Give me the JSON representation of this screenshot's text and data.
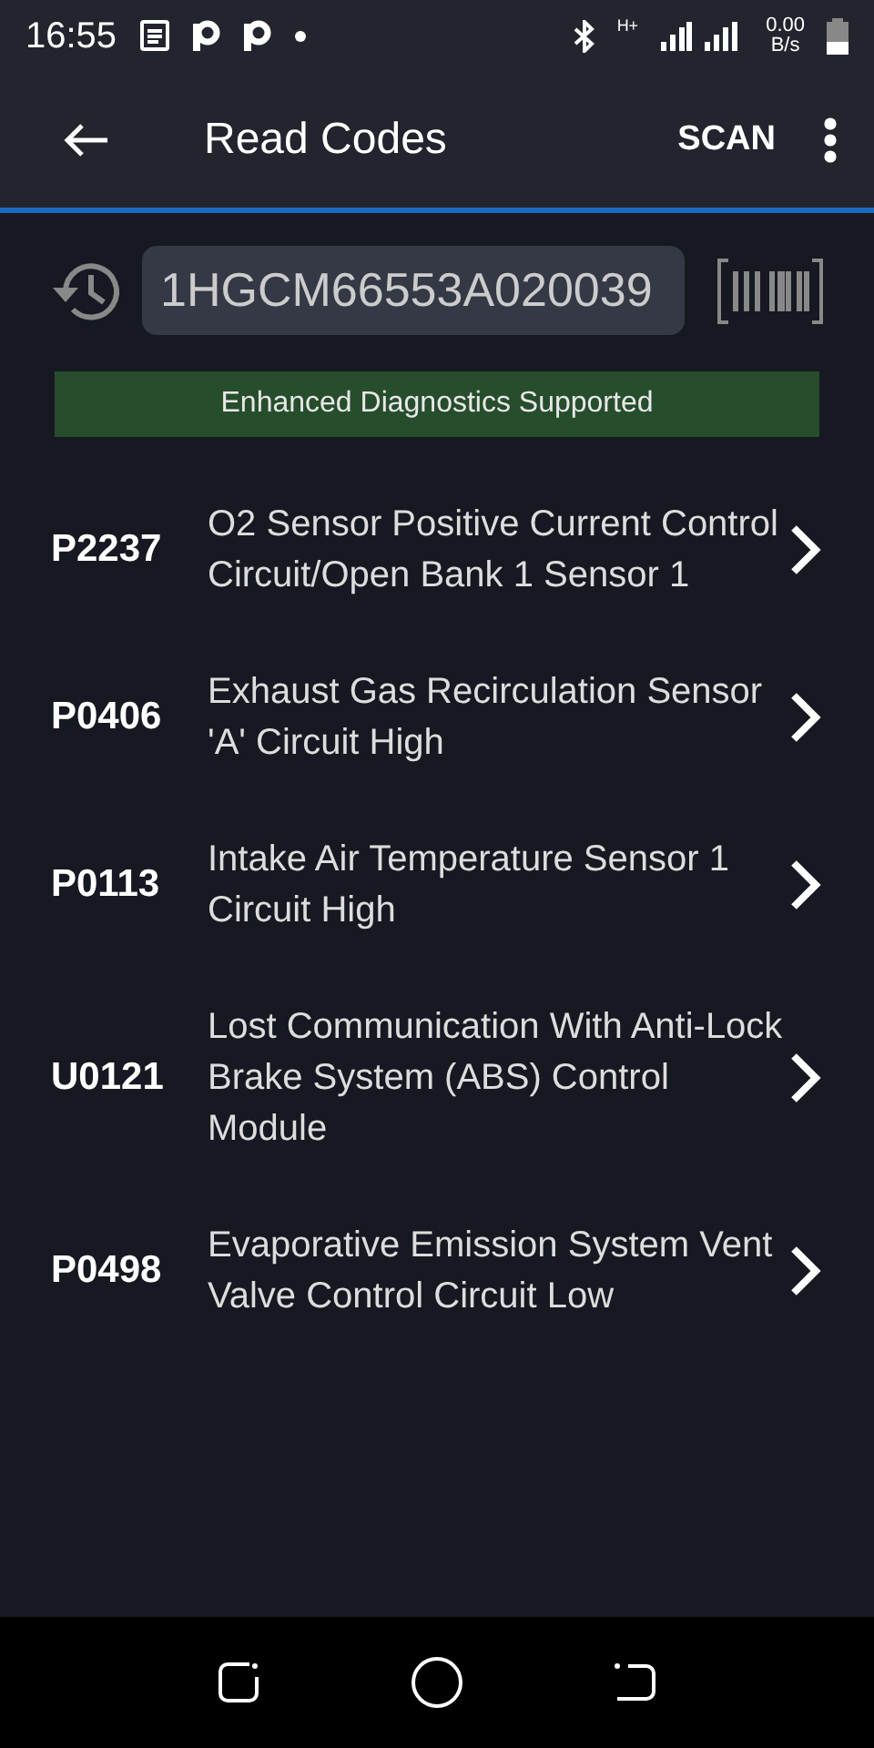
{
  "status_bar": {
    "time": "16:55",
    "network_type": "H+",
    "speed_value": "0.00",
    "speed_unit": "B/s"
  },
  "app_bar": {
    "title": "Read Codes",
    "action": "SCAN"
  },
  "vin_field": {
    "value": "1HGCM66553A020039"
  },
  "banner": "Enhanced Diagnostics Supported",
  "codes": [
    {
      "code": "P2237",
      "description": "O2 Sensor Positive Current Control Circuit/Open Bank 1 Sensor 1"
    },
    {
      "code": "P0406",
      "description": "Exhaust Gas Recirculation Sensor 'A' Circuit High"
    },
    {
      "code": "P0113",
      "description": "Intake Air Temperature Sensor 1 Circuit High"
    },
    {
      "code": "U0121",
      "description": "Lost Communication With Anti-Lock Brake System (ABS) Control Module"
    },
    {
      "code": "P0498",
      "description": "Evaporative Emission System Vent Valve Control Circuit Low"
    }
  ]
}
